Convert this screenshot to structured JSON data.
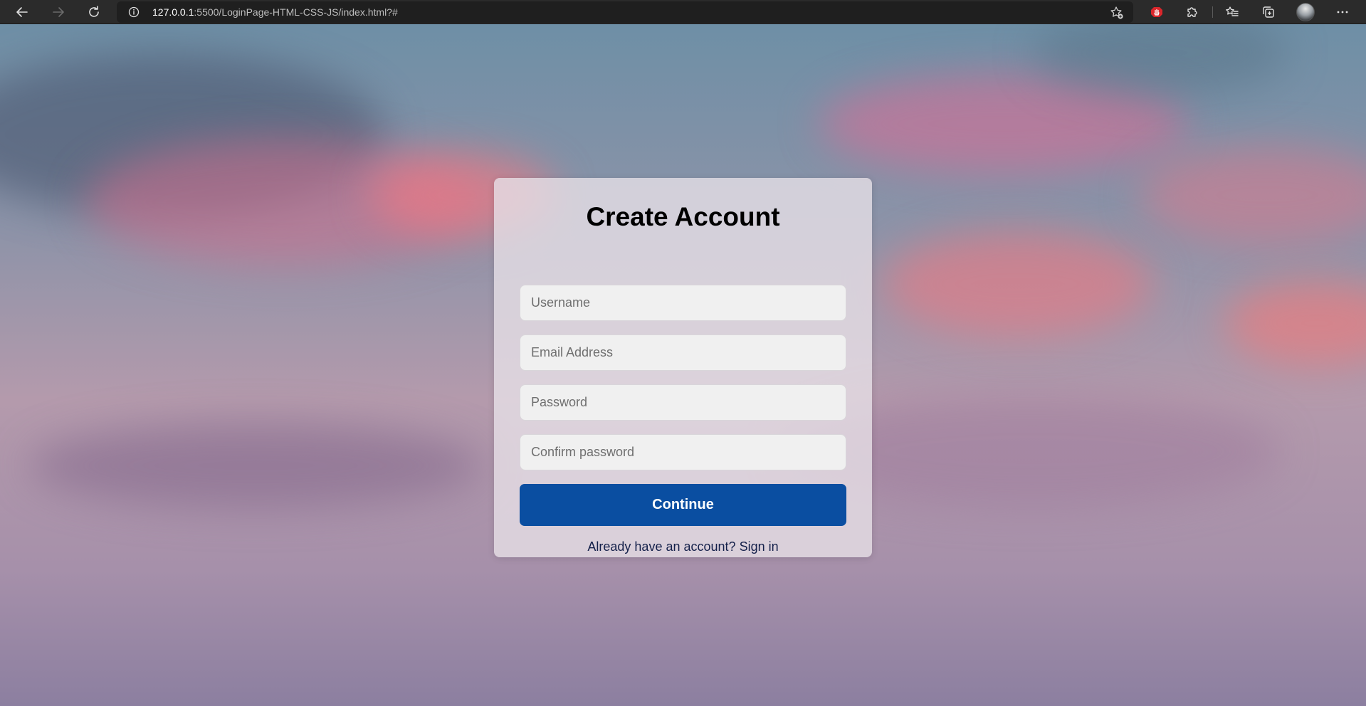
{
  "browser": {
    "url_host": "127.0.0.1",
    "url_rest": ":5500/LoginPage-HTML-CSS-JS/index.html?#",
    "icons": {
      "back": "back-arrow-icon",
      "forward": "forward-arrow-icon",
      "reload": "reload-icon",
      "site_info": "info-icon",
      "add_favorite": "star-add-icon",
      "extension_adblock": "hand-stop-icon",
      "extensions": "puzzle-icon",
      "favorites": "favorites-list-icon",
      "collections": "collections-icon",
      "menu": "more-dots-icon"
    }
  },
  "form": {
    "title": "Create Account",
    "username_placeholder": "Username",
    "email_placeholder": "Email Address",
    "password_placeholder": "Password",
    "confirm_placeholder": "Confirm password",
    "continue_label": "Continue",
    "signin_prompt": "Already have an account?",
    "signin_link": "Sign in"
  },
  "colors": {
    "button": "#0a4ea1",
    "card": "#e8e2e8",
    "browser_bar": "#2b2b2b"
  }
}
